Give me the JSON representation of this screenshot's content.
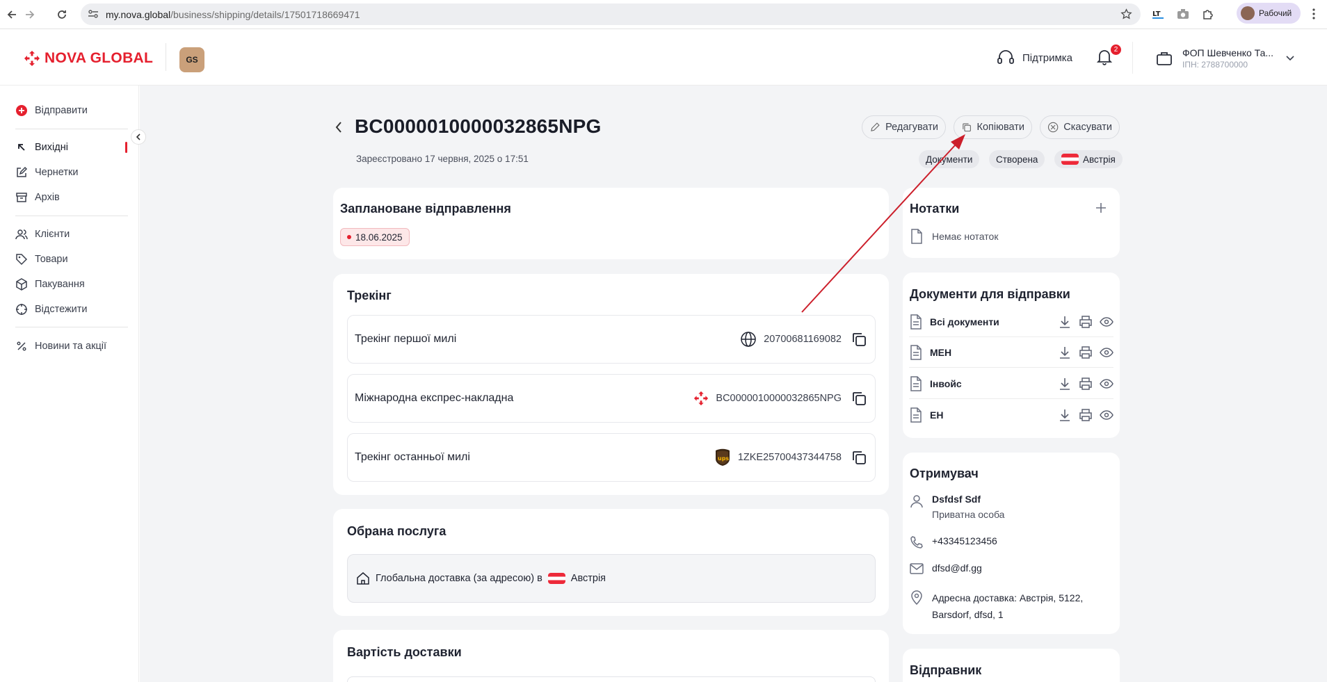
{
  "browser": {
    "url_domain": "my.nova.global",
    "url_path": "/business/shipping/details/17501718669471",
    "profile_label": "Рабочий"
  },
  "header": {
    "logo_text": "NOVA GLOBAL",
    "badge_text": "GS",
    "support_label": "Підтримка",
    "notifications_count": "2",
    "company_name": "ФОП Шевченко Та...",
    "company_ipn": "ІПН: 2788700000"
  },
  "sidebar": {
    "send_label": "Відправити",
    "items": [
      {
        "label": "Вихідні"
      },
      {
        "label": "Чернетки"
      },
      {
        "label": "Архів"
      },
      {
        "label": "Клієнти"
      },
      {
        "label": "Товари"
      },
      {
        "label": "Пакування"
      },
      {
        "label": "Відстежити"
      },
      {
        "label": "Новини та акції"
      }
    ]
  },
  "shipment": {
    "number": "BC0000010000032865NPG",
    "registered": "Зареєстровано 17 червня, 2025 о 17:51",
    "actions": {
      "edit": "Редагувати",
      "copy": "Копіювати",
      "cancel": "Скасувати"
    },
    "tags": {
      "documents": "Документи",
      "status": "Створена",
      "country": "Австрія"
    }
  },
  "planned": {
    "title": "Заплановане відправлення",
    "date": "18.06.2025"
  },
  "tracking": {
    "title": "Трекінг",
    "rows": [
      {
        "label": "Трекінг першої милі",
        "value": "20700681169082"
      },
      {
        "label": "Міжнародна експрес-накладна",
        "value": "BC0000010000032865NPG"
      },
      {
        "label": "Трекінг останньої милі",
        "value": "1ZKE25700437344758"
      }
    ]
  },
  "service": {
    "title": "Обрана послуга",
    "text": "Глобальна доставка (за адресою) в",
    "country": "Австрія"
  },
  "cost": {
    "title": "Вартість доставки"
  },
  "notes": {
    "title": "Нотатки",
    "empty": "Немає нотаток"
  },
  "documents": {
    "title": "Документи для відправки",
    "items": [
      {
        "name": "Всі документи"
      },
      {
        "name": "MEH"
      },
      {
        "name": "Інвойс"
      },
      {
        "name": "ЕН"
      }
    ]
  },
  "recipient": {
    "title": "Отримувач",
    "name": "Dsfdsf Sdf",
    "type": "Приватна особа",
    "phone": "+43345123456",
    "email": "dfsd@df.gg",
    "address_line1": "Адресна доставка: Австрія, 5122,",
    "address_line2": "Barsdorf, dfsd, 1"
  },
  "sender": {
    "title": "Відправник"
  },
  "colors": {
    "accent": "#e5202e",
    "annotation_arrow": "#cc1f2b"
  }
}
